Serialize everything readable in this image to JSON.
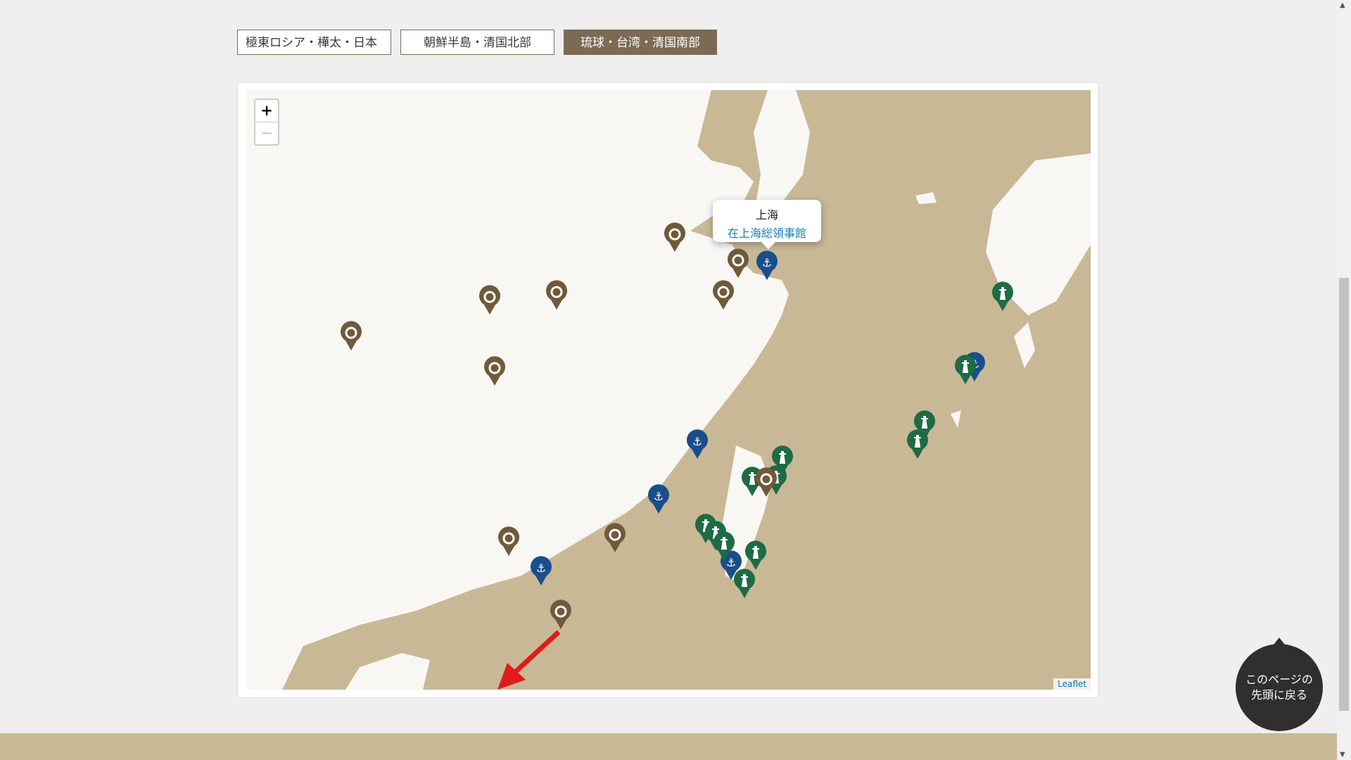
{
  "tabs": [
    {
      "label": "極東ロシア・樺太・日本",
      "active": false
    },
    {
      "label": "朝鮮半島・清国北部",
      "active": false
    },
    {
      "label": "琉球・台湾・清国南部",
      "active": true
    }
  ],
  "map": {
    "zoom_in": "+",
    "zoom_out": "−",
    "attribution": "Leaflet",
    "popup": {
      "title": "上海",
      "link": "在上海総領事館"
    },
    "colors": {
      "land": "#c8b896",
      "sea": "#f8f7f4",
      "marker_brown": "#6f5a3a",
      "marker_blue": "#1a4e8c",
      "marker_green": "#1e6b45",
      "arrow": "#e01b1b"
    }
  },
  "back_to_top": {
    "line1": "このページの",
    "line2": "先頭に戻る"
  }
}
